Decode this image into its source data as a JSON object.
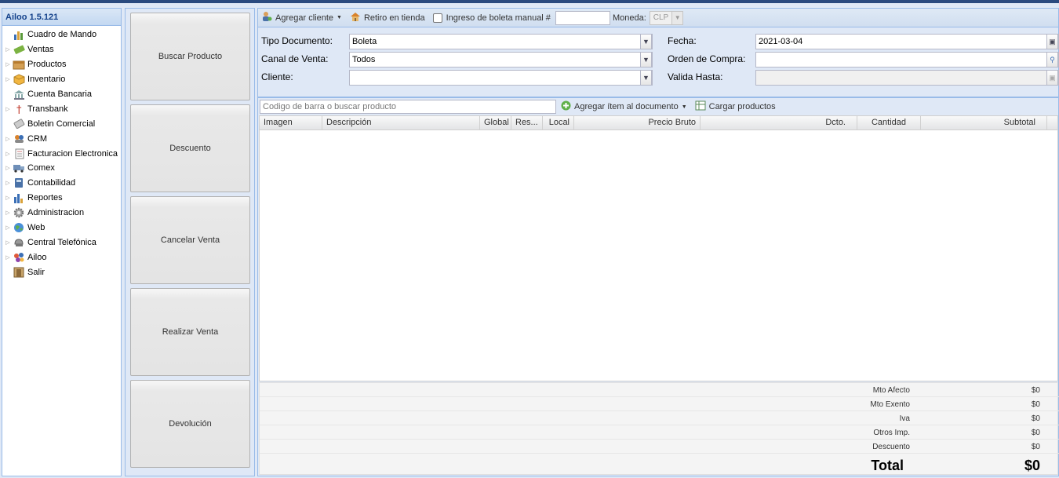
{
  "app": {
    "title": "Ailoo 1.5.121"
  },
  "sidebar": {
    "items": [
      {
        "label": "Cuadro de Mando",
        "icon": "chart-icon",
        "expandable": false
      },
      {
        "label": "Ventas",
        "icon": "money-icon",
        "expandable": true
      },
      {
        "label": "Productos",
        "icon": "box-icon",
        "expandable": true
      },
      {
        "label": "Inventario",
        "icon": "package-icon",
        "expandable": true
      },
      {
        "label": "Cuenta Bancaria",
        "icon": "bank-icon",
        "expandable": false
      },
      {
        "label": "Transbank",
        "icon": "person-icon",
        "expandable": true
      },
      {
        "label": "Boletin Comercial",
        "icon": "document-icon",
        "expandable": false
      },
      {
        "label": "CRM",
        "icon": "crm-icon",
        "expandable": true
      },
      {
        "label": "Facturacion Electronica",
        "icon": "invoice-icon",
        "expandable": true
      },
      {
        "label": "Comex",
        "icon": "truck-icon",
        "expandable": true
      },
      {
        "label": "Contabilidad",
        "icon": "calculator-icon",
        "expandable": true
      },
      {
        "label": "Reportes",
        "icon": "report-icon",
        "expandable": true
      },
      {
        "label": "Administracion",
        "icon": "gear-icon",
        "expandable": true
      },
      {
        "label": "Web",
        "icon": "globe-icon",
        "expandable": true
      },
      {
        "label": "Central Telefónica",
        "icon": "phone-icon",
        "expandable": true
      },
      {
        "label": "Ailoo",
        "icon": "ailoo-logo-icon",
        "expandable": true
      },
      {
        "label": "Salir",
        "icon": "exit-icon",
        "expandable": false
      }
    ]
  },
  "actions": {
    "search_product": "Buscar Producto",
    "discount": "Descuento",
    "cancel_sale": "Cancelar Venta",
    "make_sale": "Realizar Venta",
    "return": "Devolución"
  },
  "toolbar": {
    "add_client": "Agregar cliente",
    "store_pickup": "Retiro en tienda",
    "manual_receipt": "Ingreso de boleta manual #",
    "manual_receipt_value": "",
    "currency_label": "Moneda:",
    "currency_value": "CLP"
  },
  "form": {
    "doc_type_label": "Tipo Documento:",
    "doc_type_value": "Boleta",
    "channel_label": "Canal de Venta:",
    "channel_value": "Todos",
    "client_label": "Cliente:",
    "client_value": "",
    "date_label": "Fecha:",
    "date_value": "2021-03-04",
    "purchase_order_label": "Orden de Compra:",
    "purchase_order_value": "",
    "valid_until_label": "Valida Hasta:",
    "valid_until_value": ""
  },
  "product_bar": {
    "placeholder": "Codigo de barra o buscar producto",
    "add_item": "Agregar ítem al documento",
    "load_products": "Cargar productos"
  },
  "grid": {
    "columns": [
      "Imagen",
      "Descripción",
      "Global",
      "Res...",
      "Local",
      "Precio Bruto",
      "Dcto.",
      "Cantidad",
      "Subtotal"
    ],
    "rows": []
  },
  "totals": {
    "rows": [
      {
        "label": "Mto Afecto",
        "value": "$0"
      },
      {
        "label": "Mto Exento",
        "value": "$0"
      },
      {
        "label": "Iva",
        "value": "$0"
      },
      {
        "label": "Otros Imp.",
        "value": "$0"
      },
      {
        "label": "Descuento",
        "value": "$0"
      }
    ],
    "total_label": "Total",
    "total_value": "$0"
  }
}
